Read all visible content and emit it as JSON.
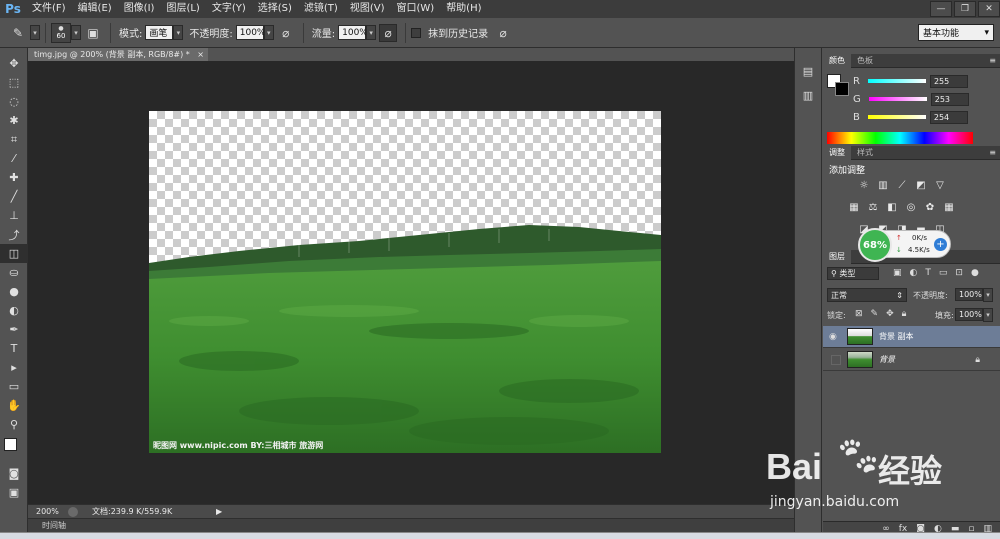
{
  "app": {
    "logo": "Ps"
  },
  "menu": [
    "文件(F)",
    "编辑(E)",
    "图像(I)",
    "图层(L)",
    "文字(Y)",
    "选择(S)",
    "滤镜(T)",
    "视图(V)",
    "窗口(W)",
    "帮助(H)"
  ],
  "window_controls": [
    "—",
    "❐",
    "✕"
  ],
  "options": {
    "brush_size": "60",
    "mode_label": "模式:",
    "mode_value": "画笔",
    "opacity_label": "不透明度:",
    "opacity_value": "100%",
    "flow_label": "流量:",
    "flow_value": "100%",
    "history_label": "抹到历史记录",
    "workspace": "基本功能"
  },
  "document": {
    "tab_title": "timg.jpg @ 200% (背景 副本, RGB/8#) *",
    "tab_close": "×",
    "watermark": "昵图网 www.nipic.com   BY:三相城市 旅游网"
  },
  "status": {
    "zoom": "200%",
    "doc_info": "文档:239.9 K/559.9K"
  },
  "timeline": {
    "label": "时间轴"
  },
  "color_panel": {
    "tabs": [
      "颜色",
      "色板"
    ],
    "channels": [
      {
        "name": "R",
        "value": "255",
        "color": "#46e0e0"
      },
      {
        "name": "G",
        "value": "253",
        "color": "#e040e0"
      },
      {
        "name": "B",
        "value": "254",
        "color": "#e0e040"
      }
    ]
  },
  "adjust_panel": {
    "tabs": [
      "调整",
      "样式"
    ],
    "title": "添加调整"
  },
  "net_widget": {
    "percent": "68%",
    "up": "0K/s",
    "down": "4.5K/s"
  },
  "layers_panel": {
    "tab": "图层",
    "filter_label": "类型",
    "blend_mode": "正常",
    "opacity_label": "不透明度:",
    "opacity_value": "100%",
    "lock_label": "锁定:",
    "fill_label": "填充:",
    "fill_value": "100%",
    "layers": [
      {
        "name": "背景 副本",
        "selected": true,
        "visible": true
      },
      {
        "name": "背景",
        "selected": false,
        "visible": false,
        "locked": true
      }
    ]
  },
  "watermark": {
    "brand": "Bai",
    "brand_cn": "经验",
    "url": "jingyan.baidu.com"
  },
  "colors": {
    "accent": "#2f7dd6",
    "canvas_bg": "#282828",
    "panel_bg": "#535353"
  }
}
